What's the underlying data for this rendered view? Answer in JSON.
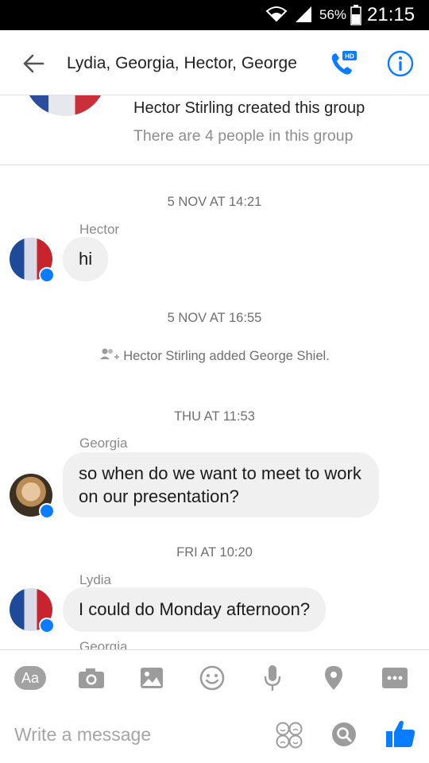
{
  "status_bar": {
    "battery_percent": "56%",
    "time": "21:15"
  },
  "header": {
    "title": "Lydia, Georgia, Hector, George",
    "call_badge": "HD",
    "icons": {
      "back": "arrow-left-icon",
      "call": "phone-hd-icon",
      "info": "info-icon"
    },
    "accent_color": "#0a7cff"
  },
  "banner": {
    "created_text": "Hector Stirling created this group",
    "member_count_text": "There are 4 people in this group"
  },
  "chat": {
    "timestamps": [
      "5 NOV AT 14:21",
      "5 NOV AT 16:55",
      "THU AT 11:53",
      "FRI AT 10:20"
    ],
    "system_message": "Hector Stirling added George Shiel.",
    "messages": [
      {
        "sender": "Hector",
        "text": "hi"
      },
      {
        "sender": "Georgia",
        "text": "so when do we want to meet to work on our presentation?"
      },
      {
        "sender": "Lydia",
        "text": "I could do Monday afternoon?"
      },
      {
        "sender": "Georgia"
      }
    ],
    "bubble_color": "#f0f0f0"
  },
  "composer": {
    "aa_label": "Aa",
    "placeholder": "Write a message",
    "toolbar_icons": [
      "text-format-icon",
      "camera-icon",
      "image-icon",
      "emoji-icon",
      "microphone-icon",
      "location-icon",
      "more-icon"
    ],
    "input_icons": [
      "sticker-icon",
      "search-icon",
      "thumbs-up-icon"
    ]
  }
}
